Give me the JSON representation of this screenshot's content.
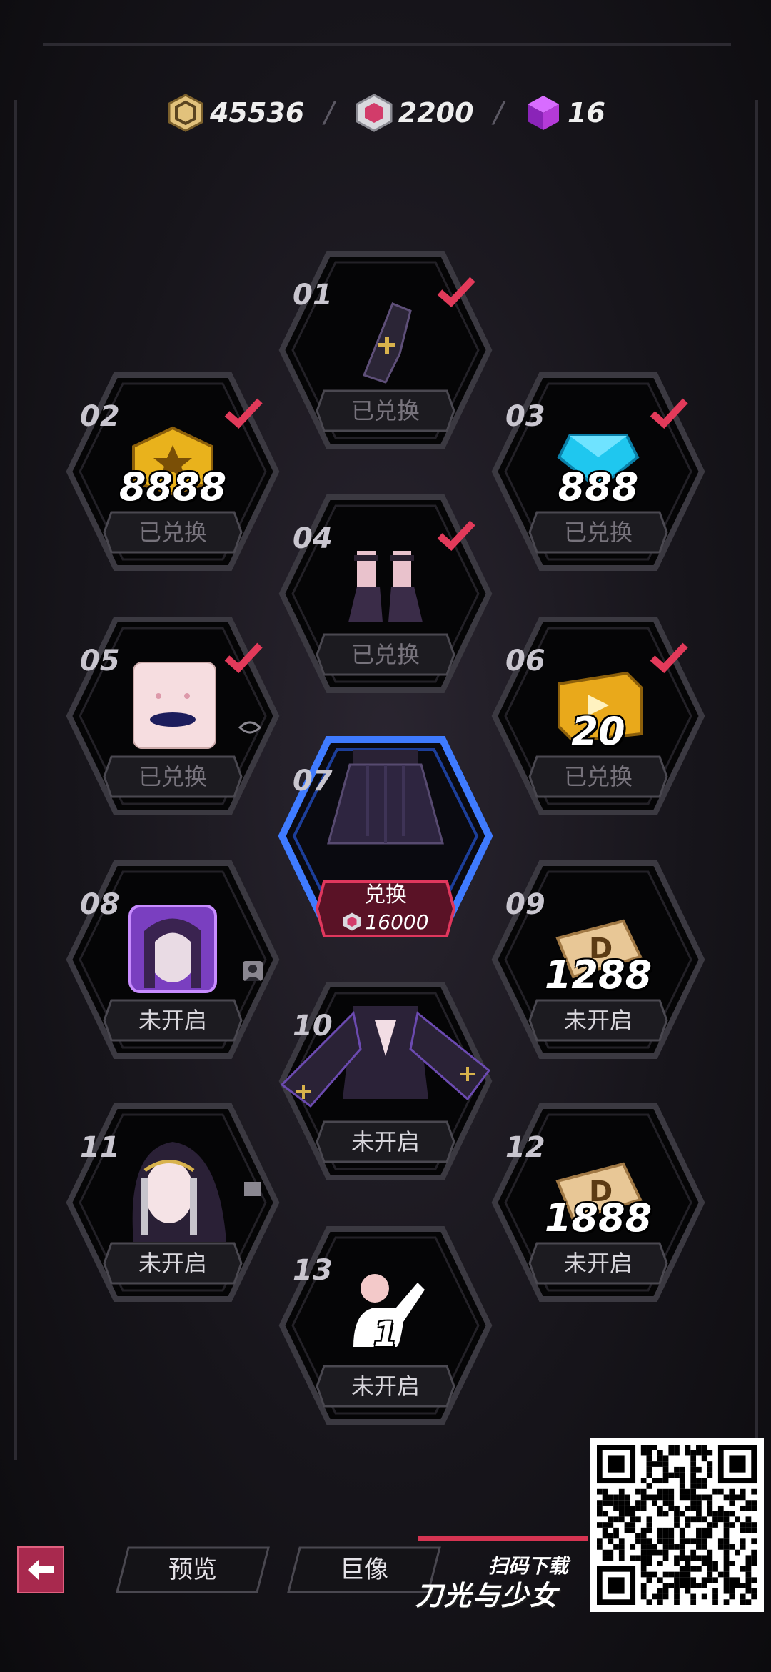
{
  "currencies": [
    {
      "name": "gold-coin",
      "value": "45536",
      "color": "#e2c27c"
    },
    {
      "name": "crystal-gem",
      "value": "2200",
      "color": "#d23c6a"
    },
    {
      "name": "purple-cube",
      "value": "16",
      "color": "#b43ad8"
    }
  ],
  "nodes": [
    {
      "num": "01",
      "status": "已兑换",
      "redeemed": true,
      "qty": ""
    },
    {
      "num": "02",
      "status": "已兑换",
      "redeemed": true,
      "qty": "8888"
    },
    {
      "num": "03",
      "status": "已兑换",
      "redeemed": true,
      "qty": "888"
    },
    {
      "num": "04",
      "status": "已兑换",
      "redeemed": true,
      "qty": ""
    },
    {
      "num": "05",
      "status": "已兑换",
      "redeemed": true,
      "qty": ""
    },
    {
      "num": "06",
      "status": "已兑换",
      "redeemed": true,
      "qty": "20"
    },
    {
      "num": "07",
      "status": "兑换",
      "redeemed": false,
      "qty": "",
      "cost": "16000"
    },
    {
      "num": "08",
      "status": "未开启",
      "redeemed": false,
      "qty": ""
    },
    {
      "num": "09",
      "status": "未开启",
      "redeemed": false,
      "qty": "1288"
    },
    {
      "num": "10",
      "status": "未开启",
      "redeemed": false,
      "qty": ""
    },
    {
      "num": "11",
      "status": "未开启",
      "redeemed": false,
      "qty": ""
    },
    {
      "num": "12",
      "status": "未开启",
      "redeemed": false,
      "qty": "1888"
    },
    {
      "num": "13",
      "status": "未开启",
      "redeemed": false,
      "qty": "1"
    }
  ],
  "bottom": {
    "preview_label": "预览",
    "statue_label": "巨像",
    "scan_label": "扫码下载",
    "brand": "刀光与少女"
  },
  "colors": {
    "accent": "#d63452",
    "check": "#e23a5a",
    "blue_glow": "#3f7bff"
  }
}
